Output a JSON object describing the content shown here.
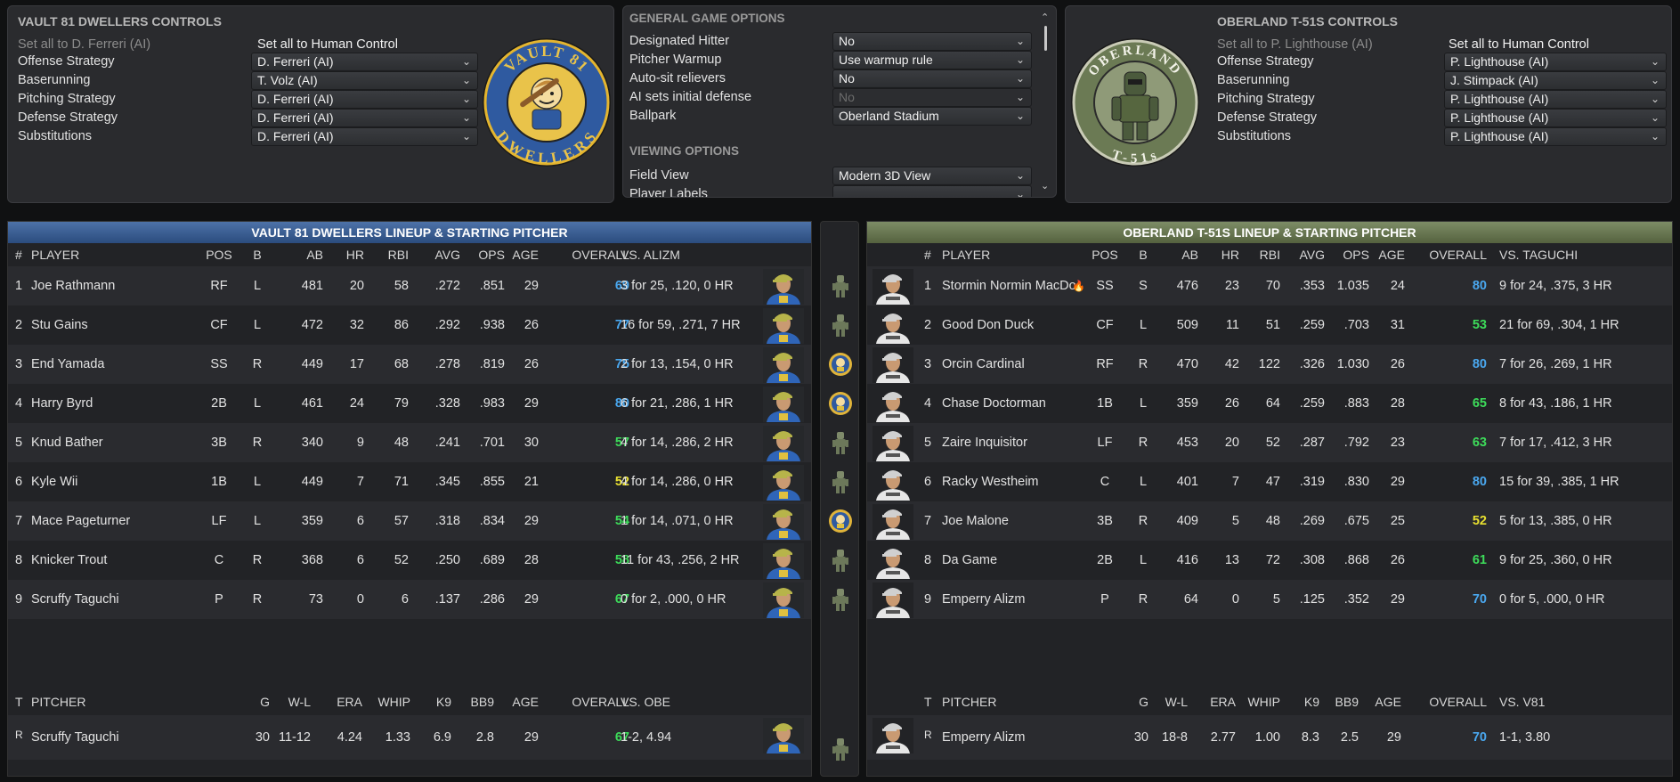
{
  "colors": {
    "blue": "#4aa8f0",
    "green": "#3ddc5a",
    "yellow": "#e8e030",
    "vault_banner": "#3d5f92",
    "oberland_banner": "#66754d"
  },
  "home_controls": {
    "title": "VAULT 81 DWELLERS CONTROLS",
    "set_ai": "Set all to D. Ferreri (AI)",
    "set_human": "Set all to Human Control",
    "rows": [
      {
        "label": "Offense Strategy",
        "value": "D. Ferreri (AI)"
      },
      {
        "label": "Baserunning",
        "value": "T. Volz (AI)"
      },
      {
        "label": "Pitching Strategy",
        "value": "D. Ferreri (AI)"
      },
      {
        "label": "Defense Strategy",
        "value": "D. Ferreri (AI)"
      },
      {
        "label": "Substitutions",
        "value": "D. Ferreri (AI)"
      }
    ],
    "logo": {
      "top": "VAULT 81",
      "bottom": "DWELLERS"
    }
  },
  "options": {
    "title": "GENERAL GAME OPTIONS",
    "rows": [
      {
        "label": "Designated Hitter",
        "value": "No"
      },
      {
        "label": "Pitcher Warmup",
        "value": "Use warmup rule"
      },
      {
        "label": "Auto-sit relievers",
        "value": "No"
      },
      {
        "label": "AI sets initial defense",
        "value": "No"
      },
      {
        "label": "Ballpark",
        "value": "Oberland Stadium"
      }
    ],
    "viewing_title": "VIEWING OPTIONS",
    "view_rows": [
      {
        "label": "Field View",
        "value": "Modern 3D View"
      },
      {
        "label": "Player Labels",
        "value": ""
      }
    ]
  },
  "away_controls": {
    "title": "OBERLAND T-51S CONTROLS",
    "set_ai": "Set all to P. Lighthouse (AI)",
    "set_human": "Set all to Human Control",
    "rows": [
      {
        "label": "Offense Strategy",
        "value": "P. Lighthouse (AI)"
      },
      {
        "label": "Baserunning",
        "value": "J. Stimpack (AI)"
      },
      {
        "label": "Pitching Strategy",
        "value": "P. Lighthouse (AI)"
      },
      {
        "label": "Defense Strategy",
        "value": "P. Lighthouse (AI)"
      },
      {
        "label": "Substitutions",
        "value": "P. Lighthouse (AI)"
      }
    ],
    "logo": {
      "top": "OBERLAND",
      "bottom": "T-51s"
    }
  },
  "home_lineup": {
    "banner": "VAULT 81 DWELLERS LINEUP & STARTING PITCHER",
    "headers": {
      "num": "#",
      "player": "PLAYER",
      "pos": "POS",
      "b": "B",
      "ab": "AB",
      "hr": "HR",
      "rbi": "RBI",
      "avg": "AVG",
      "ops": "OPS",
      "age": "AGE",
      "overall": "OVERALL",
      "vs": "VS. ALIZM"
    },
    "players": [
      {
        "num": "1",
        "name": "Joe Rathmann",
        "pos": "RF",
        "b": "L",
        "ab": "481",
        "hr": "20",
        "rbi": "58",
        "avg": ".272",
        "ops": ".851",
        "age": "29",
        "overall": "69",
        "ov_color": "blue",
        "vs": "3 for 25, .120, 0 HR"
      },
      {
        "num": "2",
        "name": "Stu Gains",
        "pos": "CF",
        "b": "L",
        "ab": "472",
        "hr": "32",
        "rbi": "86",
        "avg": ".292",
        "ops": ".938",
        "age": "26",
        "overall": "77",
        "ov_color": "blue",
        "vs": "16 for 59, .271, 7 HR"
      },
      {
        "num": "3",
        "name": "End Yamada",
        "pos": "SS",
        "b": "R",
        "ab": "449",
        "hr": "17",
        "rbi": "68",
        "avg": ".278",
        "ops": ".819",
        "age": "26",
        "overall": "75",
        "ov_color": "blue",
        "vs": "2 for 13, .154, 0 HR"
      },
      {
        "num": "4",
        "name": "Harry Byrd",
        "pos": "2B",
        "b": "L",
        "ab": "461",
        "hr": "24",
        "rbi": "79",
        "avg": ".328",
        "ops": ".983",
        "age": "29",
        "overall": "80",
        "ov_color": "blue",
        "vs": "6 for 21, .286, 1 HR"
      },
      {
        "num": "5",
        "name": "Knud Bather",
        "pos": "3B",
        "b": "R",
        "ab": "340",
        "hr": "9",
        "rbi": "48",
        "avg": ".241",
        "ops": ".701",
        "age": "30",
        "overall": "57",
        "ov_color": "green",
        "vs": "4 for 14, .286, 2 HR"
      },
      {
        "num": "6",
        "name": "Kyle Wii",
        "pos": "1B",
        "b": "L",
        "ab": "449",
        "hr": "7",
        "rbi": "71",
        "avg": ".345",
        "ops": ".855",
        "age": "21",
        "overall": "52",
        "ov_color": "yellow",
        "vs": "4 for 14, .286, 0 HR"
      },
      {
        "num": "7",
        "name": "Mace Pageturner",
        "pos": "LF",
        "b": "L",
        "ab": "359",
        "hr": "6",
        "rbi": "57",
        "avg": ".318",
        "ops": ".834",
        "age": "29",
        "overall": "54",
        "ov_color": "green",
        "vs": "1 for 14, .071, 0 HR"
      },
      {
        "num": "8",
        "name": "Knicker Trout",
        "pos": "C",
        "b": "R",
        "ab": "368",
        "hr": "6",
        "rbi": "52",
        "avg": ".250",
        "ops": ".689",
        "age": "28",
        "overall": "58",
        "ov_color": "green",
        "vs": "11 for 43, .256, 2 HR"
      },
      {
        "num": "9",
        "name": "Scruffy Taguchi",
        "pos": "P",
        "b": "R",
        "ab": "73",
        "hr": "0",
        "rbi": "6",
        "avg": ".137",
        "ops": ".286",
        "age": "29",
        "overall": "67",
        "ov_color": "green",
        "vs": "0 for 2, .000, 0 HR"
      }
    ],
    "pitcher_headers": {
      "t": "T",
      "pitcher": "PITCHER",
      "g": "G",
      "wl": "W-L",
      "era": "ERA",
      "whip": "WHIP",
      "k9": "K9",
      "bb9": "BB9",
      "age": "AGE",
      "overall": "OVERALL",
      "vs": "VS. OBE"
    },
    "pitcher": {
      "t": "R",
      "name": "Scruffy Taguchi",
      "g": "30",
      "wl": "11-12",
      "era": "4.24",
      "whip": "1.33",
      "k9": "6.9",
      "bb9": "2.8",
      "age": "29",
      "overall": "67",
      "ov_color": "green",
      "vs": "1-2, 4.94"
    }
  },
  "away_lineup": {
    "banner": "OBERLAND T-51S LINEUP & STARTING PITCHER",
    "headers": {
      "num": "#",
      "player": "PLAYER",
      "pos": "POS",
      "b": "B",
      "ab": "AB",
      "hr": "HR",
      "rbi": "RBI",
      "avg": "AVG",
      "ops": "OPS",
      "age": "AGE",
      "overall": "OVERALL",
      "vs": "VS. TAGUCHI"
    },
    "players": [
      {
        "num": "1",
        "name": "Stormin Normin MacDo",
        "pos": "SS",
        "b": "S",
        "ab": "476",
        "hr": "23",
        "rbi": "70",
        "avg": ".353",
        "ops": "1.035",
        "age": "24",
        "overall": "80",
        "ov_color": "blue",
        "vs": "9 for 24, .375, 3 HR",
        "hot": true
      },
      {
        "num": "2",
        "name": "Good Don Duck",
        "pos": "CF",
        "b": "L",
        "ab": "509",
        "hr": "11",
        "rbi": "51",
        "avg": ".259",
        "ops": ".703",
        "age": "31",
        "overall": "53",
        "ov_color": "green",
        "vs": "21 for 69, .304, 1 HR"
      },
      {
        "num": "3",
        "name": "Orcin Cardinal",
        "pos": "RF",
        "b": "R",
        "ab": "470",
        "hr": "42",
        "rbi": "122",
        "avg": ".326",
        "ops": "1.030",
        "age": "26",
        "overall": "80",
        "ov_color": "blue",
        "vs": "7 for 26, .269, 1 HR"
      },
      {
        "num": "4",
        "name": "Chase Doctorman",
        "pos": "1B",
        "b": "L",
        "ab": "359",
        "hr": "26",
        "rbi": "64",
        "avg": ".259",
        "ops": ".883",
        "age": "28",
        "overall": "65",
        "ov_color": "green",
        "vs": "8 for 43, .186, 1 HR"
      },
      {
        "num": "5",
        "name": "Zaire Inquisitor",
        "pos": "LF",
        "b": "R",
        "ab": "453",
        "hr": "20",
        "rbi": "52",
        "avg": ".287",
        "ops": ".792",
        "age": "23",
        "overall": "63",
        "ov_color": "green",
        "vs": "7 for 17, .412, 3 HR"
      },
      {
        "num": "6",
        "name": "Racky Westheim",
        "pos": "C",
        "b": "L",
        "ab": "401",
        "hr": "7",
        "rbi": "47",
        "avg": ".319",
        "ops": ".830",
        "age": "29",
        "overall": "80",
        "ov_color": "blue",
        "vs": "15 for 39, .385, 1 HR"
      },
      {
        "num": "7",
        "name": "Joe Malone",
        "pos": "3B",
        "b": "R",
        "ab": "409",
        "hr": "5",
        "rbi": "48",
        "avg": ".269",
        "ops": ".675",
        "age": "25",
        "overall": "52",
        "ov_color": "yellow",
        "vs": "5 for 13, .385, 0 HR"
      },
      {
        "num": "8",
        "name": "Da Game",
        "pos": "2B",
        "b": "L",
        "ab": "416",
        "hr": "13",
        "rbi": "72",
        "avg": ".308",
        "ops": ".868",
        "age": "26",
        "overall": "61",
        "ov_color": "green",
        "vs": "9 for 25, .360, 0 HR"
      },
      {
        "num": "9",
        "name": "Emperry Alizm",
        "pos": "P",
        "b": "R",
        "ab": "64",
        "hr": "0",
        "rbi": "5",
        "avg": ".125",
        "ops": ".352",
        "age": "29",
        "overall": "70",
        "ov_color": "blue",
        "vs": "0 for 5, .000, 0 HR"
      }
    ],
    "pitcher_headers": {
      "t": "T",
      "pitcher": "PITCHER",
      "g": "G",
      "wl": "W-L",
      "era": "ERA",
      "whip": "WHIP",
      "k9": "K9",
      "bb9": "BB9",
      "age": "AGE",
      "overall": "OVERALL",
      "vs": "VS. V81"
    },
    "pitcher": {
      "t": "R",
      "name": "Emperry Alizm",
      "g": "30",
      "wl": "18-8",
      "era": "2.77",
      "whip": "1.00",
      "k9": "8.3",
      "bb9": "2.5",
      "age": "29",
      "overall": "70",
      "ov_color": "blue",
      "vs": "1-1, 3.80"
    }
  },
  "divider_icons": [
    "armor-icon",
    "armor-icon",
    "vault-boy-icon",
    "vault-boy-icon",
    "armor-icon",
    "armor-icon",
    "vault-boy-icon",
    "armor-icon",
    "armor-icon",
    "armor-icon"
  ]
}
